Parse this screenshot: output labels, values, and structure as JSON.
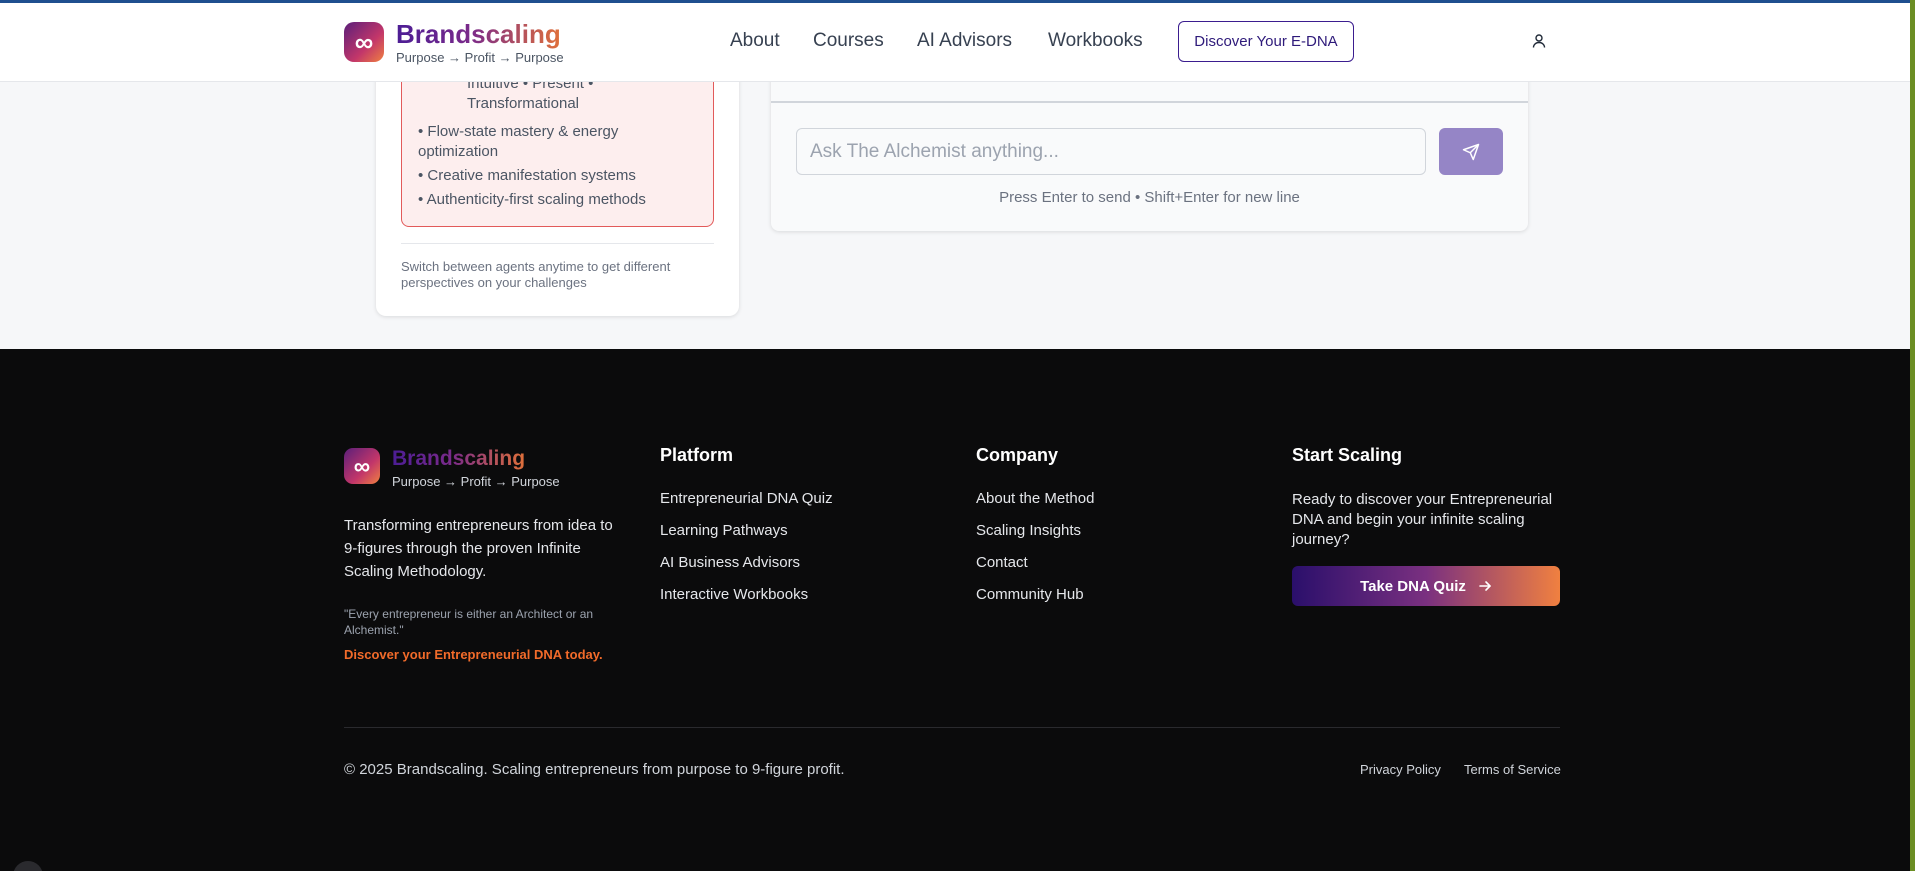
{
  "header": {
    "brand": "Brandscaling",
    "tagline": "Purpose → Profit → Purpose",
    "logo_icon": "infinity-icon",
    "logo_glyph": "∞",
    "nav": {
      "about": "About",
      "courses": "Courses",
      "advisors": "AI Advisors",
      "workbooks": "Workbooks"
    },
    "cta": "Discover Your E-DNA",
    "user_icon": "user-icon"
  },
  "agents_card": {
    "traits": "Intuitive • Present • Transformational",
    "features": [
      "• Flow-state mastery & energy optimization",
      "• Creative manifestation systems",
      "• Authenticity-first scaling methods"
    ],
    "note": "Switch between agents anytime to get different perspectives on your challenges",
    "accent_border": "#e25a5a",
    "accent_bg": "#fdeeee"
  },
  "chat": {
    "placeholder": "Ask The Alchemist anything...",
    "hint": "Press Enter to send • Shift+Enter for new line",
    "send_icon": "send-icon",
    "send_color": "#9585c6"
  },
  "footer": {
    "brand": "Brandscaling",
    "tagline": "Purpose → Profit → Purpose",
    "logo_glyph": "∞",
    "description": "Transforming entrepreneurs from idea to 9-figures through the proven Infinite Scaling Methodology.",
    "quote": "\"Every entrepreneur is either an Architect or an Alchemist.\"",
    "cta_text": "Discover your Entrepreneurial DNA today.",
    "platform": {
      "title": "Platform",
      "links": [
        "Entrepreneurial DNA Quiz",
        "Learning Pathways",
        "AI Business Advisors",
        "Interactive Workbooks"
      ]
    },
    "company": {
      "title": "Company",
      "links": [
        "About the Method",
        "Scaling Insights",
        "Contact",
        "Community Hub"
      ]
    },
    "start": {
      "title": "Start Scaling",
      "text": "Ready to discover your Entrepreneurial DNA and begin your infinite scaling journey?",
      "button": "Take DNA Quiz",
      "button_icon": "arrow-right-icon"
    },
    "copyright": "© 2025 Brandscaling. Scaling entrepreneurs from purpose to 9-figure profit.",
    "legal": {
      "privacy": "Privacy Policy",
      "terms": "Terms of Service"
    },
    "background": "#0b0b0c",
    "accent": "#f26b2a"
  }
}
